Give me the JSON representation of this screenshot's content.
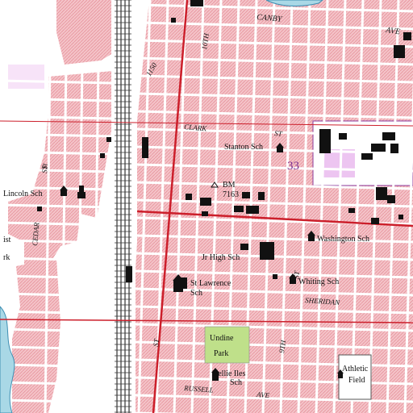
{
  "map": {
    "type": "topographic",
    "colors": {
      "urban": "#f2b7bd",
      "street": "#ffffff",
      "major_road": "#cc1f2b",
      "survey_line": "#cc1f2b",
      "railroad": "#333333",
      "park": "#bfe08a",
      "water": "#a9d8e6",
      "building": "#111111",
      "purple_overprint": "#8b3a9b",
      "label": "#111111"
    }
  },
  "labels": {
    "canby": "CANBY",
    "ave_top": "AVE",
    "clark": "CLARK",
    "st_clark": "ST",
    "route": "1150",
    "stanton": "Stanton Sch",
    "section": "33",
    "bm": "BM",
    "bm_value": "7163",
    "lincoln": "Lincoln Sch",
    "washington": "Washington Sch",
    "jr_high": "Jr High Sch",
    "whiting": "Whiting Sch",
    "st_lawrence": "St Lawrence",
    "st_lawrence_sch": "Sch",
    "sheridan": "SHERIDAN",
    "undine": "Undine",
    "park": "Park",
    "nellie_iles": "Nellie Iles",
    "nellie_sch": "Sch",
    "athletic": "Athletic",
    "field": "Field",
    "russell": "RUSSELL",
    "ave_bottom": "AVE",
    "cedar": "CEDAR",
    "st_cedar": "ST",
    "ninth": "9TH",
    "st_ninth": "ST",
    "st_ninth2": "ST",
    "tenth": "10TH",
    "ist": "ist",
    "rk": "rk",
    "st_left": "St"
  }
}
